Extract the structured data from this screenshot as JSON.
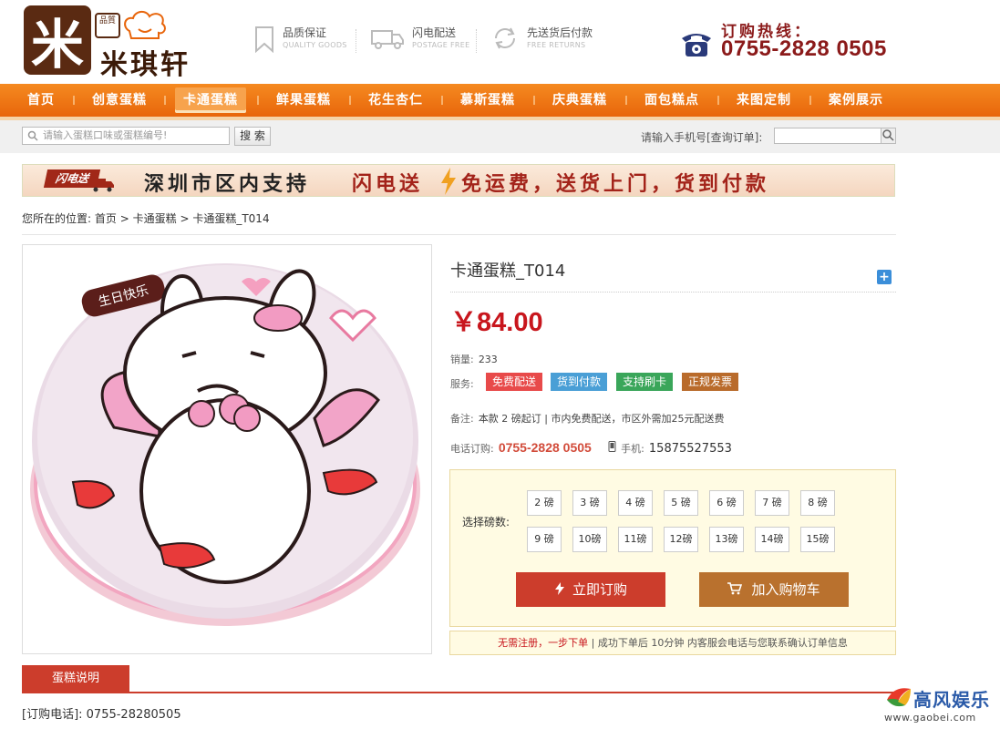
{
  "header": {
    "logo_glyph": "米",
    "logo_small": "品質",
    "brand_name": "米琪轩",
    "features": [
      {
        "title": "品质保证",
        "sub": "QUALITY GOODS",
        "icon": "bookmark-icon"
      },
      {
        "title": "闪电配送",
        "sub": "POSTAGE FREE",
        "icon": "truck-icon"
      },
      {
        "title": "先送货后付款",
        "sub": "FREE RETURNS",
        "icon": "return-icon"
      }
    ],
    "hotline_label": "订购热线：",
    "hotline_number": "0755-2828 0505"
  },
  "nav": {
    "items": [
      "首页",
      "创意蛋糕",
      "卡通蛋糕",
      "鲜果蛋糕",
      "花生杏仁",
      "慕斯蛋糕",
      "庆典蛋糕",
      "面包糕点",
      "来图定制",
      "案例展示"
    ],
    "active_index": 2
  },
  "search": {
    "placeholder": "请输入蛋糕口味或蛋糕编号!",
    "button": "搜 索",
    "order_query_label": "请输入手机号[查询订单]:"
  },
  "banner": {
    "badge": "闪电送",
    "text1": "深圳市区内支持",
    "text2": "闪电送",
    "text3": "免运费，送货上门，货到付款"
  },
  "breadcrumb": {
    "prefix": "您所在的位置:",
    "items": [
      "首页",
      "卡通蛋糕",
      "卡通蛋糕_T014"
    ],
    "separator": ">"
  },
  "product": {
    "image_text": "生日快乐",
    "title": "卡通蛋糕_T014",
    "price": "￥84.00",
    "sales_label": "销量:",
    "sales_value": "233",
    "service_label": "服务:",
    "tags": [
      {
        "label": "免费配送",
        "color": "#e84a4a"
      },
      {
        "label": "货到付款",
        "color": "#4a9fd6"
      },
      {
        "label": "支持刷卡",
        "color": "#3aa65a"
      },
      {
        "label": "正规发票",
        "color": "#b96b2b"
      }
    ],
    "note_label": "备注:",
    "note_text": "本款 2 磅起订 | 市内免费配送，市区外需加25元配送费",
    "phone_label": "电话订购:",
    "phone_number": "0755-2828 0505",
    "mobile_label": "手机:",
    "mobile_number": "15875527553",
    "weight_label": "选择磅数:",
    "weights": [
      "2 磅",
      "3 磅",
      "4 磅",
      "5 磅",
      "6 磅",
      "7 磅",
      "8 磅",
      "9 磅",
      "10磅",
      "11磅",
      "12磅",
      "13磅",
      "14磅",
      "15磅"
    ],
    "buy_button": "立即订购",
    "cart_button": "加入购物车",
    "notice_strong": "无需注册，一步下单",
    "notice_text": " | 成功下单后 10分钟 内客服会电话与您联系确认订单信息"
  },
  "tabs": {
    "active": "蛋糕说明"
  },
  "description": {
    "phone_line": "[订购电话]: 0755-28280505"
  },
  "watermark": {
    "name": "高风娱乐",
    "url": "www.gaobei.com"
  },
  "colors": {
    "nav_orange": "#f07a18",
    "price_red": "#c8161d",
    "brand_brown": "#5a2a12",
    "buy_red": "#cc3d2c",
    "cart_brown": "#b9712e"
  }
}
